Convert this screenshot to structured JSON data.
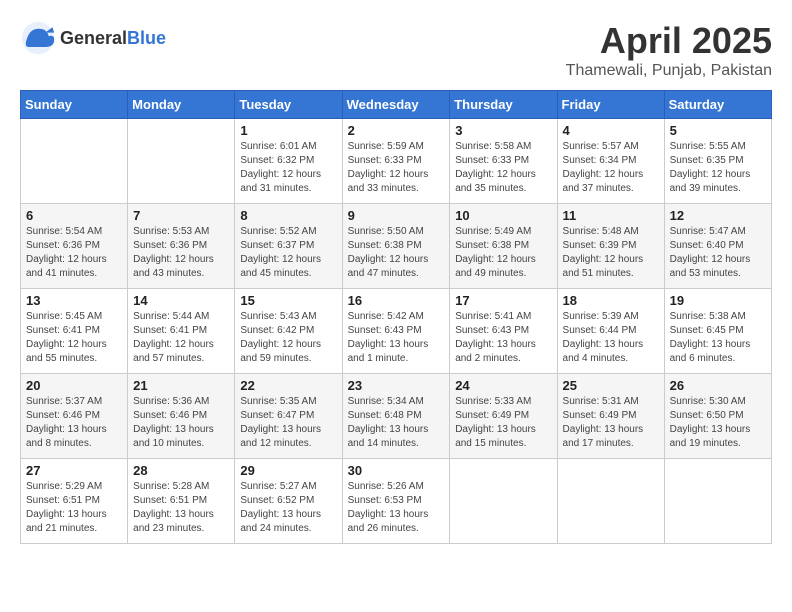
{
  "header": {
    "logo_general": "General",
    "logo_blue": "Blue",
    "title": "April 2025",
    "location": "Thamewali, Punjab, Pakistan"
  },
  "days_of_week": [
    "Sunday",
    "Monday",
    "Tuesday",
    "Wednesday",
    "Thursday",
    "Friday",
    "Saturday"
  ],
  "weeks": [
    [
      {
        "day": "",
        "info": ""
      },
      {
        "day": "",
        "info": ""
      },
      {
        "day": "1",
        "info": "Sunrise: 6:01 AM\nSunset: 6:32 PM\nDaylight: 12 hours and 31 minutes."
      },
      {
        "day": "2",
        "info": "Sunrise: 5:59 AM\nSunset: 6:33 PM\nDaylight: 12 hours and 33 minutes."
      },
      {
        "day": "3",
        "info": "Sunrise: 5:58 AM\nSunset: 6:33 PM\nDaylight: 12 hours and 35 minutes."
      },
      {
        "day": "4",
        "info": "Sunrise: 5:57 AM\nSunset: 6:34 PM\nDaylight: 12 hours and 37 minutes."
      },
      {
        "day": "5",
        "info": "Sunrise: 5:55 AM\nSunset: 6:35 PM\nDaylight: 12 hours and 39 minutes."
      }
    ],
    [
      {
        "day": "6",
        "info": "Sunrise: 5:54 AM\nSunset: 6:36 PM\nDaylight: 12 hours and 41 minutes."
      },
      {
        "day": "7",
        "info": "Sunrise: 5:53 AM\nSunset: 6:36 PM\nDaylight: 12 hours and 43 minutes."
      },
      {
        "day": "8",
        "info": "Sunrise: 5:52 AM\nSunset: 6:37 PM\nDaylight: 12 hours and 45 minutes."
      },
      {
        "day": "9",
        "info": "Sunrise: 5:50 AM\nSunset: 6:38 PM\nDaylight: 12 hours and 47 minutes."
      },
      {
        "day": "10",
        "info": "Sunrise: 5:49 AM\nSunset: 6:38 PM\nDaylight: 12 hours and 49 minutes."
      },
      {
        "day": "11",
        "info": "Sunrise: 5:48 AM\nSunset: 6:39 PM\nDaylight: 12 hours and 51 minutes."
      },
      {
        "day": "12",
        "info": "Sunrise: 5:47 AM\nSunset: 6:40 PM\nDaylight: 12 hours and 53 minutes."
      }
    ],
    [
      {
        "day": "13",
        "info": "Sunrise: 5:45 AM\nSunset: 6:41 PM\nDaylight: 12 hours and 55 minutes."
      },
      {
        "day": "14",
        "info": "Sunrise: 5:44 AM\nSunset: 6:41 PM\nDaylight: 12 hours and 57 minutes."
      },
      {
        "day": "15",
        "info": "Sunrise: 5:43 AM\nSunset: 6:42 PM\nDaylight: 12 hours and 59 minutes."
      },
      {
        "day": "16",
        "info": "Sunrise: 5:42 AM\nSunset: 6:43 PM\nDaylight: 13 hours and 1 minute."
      },
      {
        "day": "17",
        "info": "Sunrise: 5:41 AM\nSunset: 6:43 PM\nDaylight: 13 hours and 2 minutes."
      },
      {
        "day": "18",
        "info": "Sunrise: 5:39 AM\nSunset: 6:44 PM\nDaylight: 13 hours and 4 minutes."
      },
      {
        "day": "19",
        "info": "Sunrise: 5:38 AM\nSunset: 6:45 PM\nDaylight: 13 hours and 6 minutes."
      }
    ],
    [
      {
        "day": "20",
        "info": "Sunrise: 5:37 AM\nSunset: 6:46 PM\nDaylight: 13 hours and 8 minutes."
      },
      {
        "day": "21",
        "info": "Sunrise: 5:36 AM\nSunset: 6:46 PM\nDaylight: 13 hours and 10 minutes."
      },
      {
        "day": "22",
        "info": "Sunrise: 5:35 AM\nSunset: 6:47 PM\nDaylight: 13 hours and 12 minutes."
      },
      {
        "day": "23",
        "info": "Sunrise: 5:34 AM\nSunset: 6:48 PM\nDaylight: 13 hours and 14 minutes."
      },
      {
        "day": "24",
        "info": "Sunrise: 5:33 AM\nSunset: 6:49 PM\nDaylight: 13 hours and 15 minutes."
      },
      {
        "day": "25",
        "info": "Sunrise: 5:31 AM\nSunset: 6:49 PM\nDaylight: 13 hours and 17 minutes."
      },
      {
        "day": "26",
        "info": "Sunrise: 5:30 AM\nSunset: 6:50 PM\nDaylight: 13 hours and 19 minutes."
      }
    ],
    [
      {
        "day": "27",
        "info": "Sunrise: 5:29 AM\nSunset: 6:51 PM\nDaylight: 13 hours and 21 minutes."
      },
      {
        "day": "28",
        "info": "Sunrise: 5:28 AM\nSunset: 6:51 PM\nDaylight: 13 hours and 23 minutes."
      },
      {
        "day": "29",
        "info": "Sunrise: 5:27 AM\nSunset: 6:52 PM\nDaylight: 13 hours and 24 minutes."
      },
      {
        "day": "30",
        "info": "Sunrise: 5:26 AM\nSunset: 6:53 PM\nDaylight: 13 hours and 26 minutes."
      },
      {
        "day": "",
        "info": ""
      },
      {
        "day": "",
        "info": ""
      },
      {
        "day": "",
        "info": ""
      }
    ]
  ]
}
